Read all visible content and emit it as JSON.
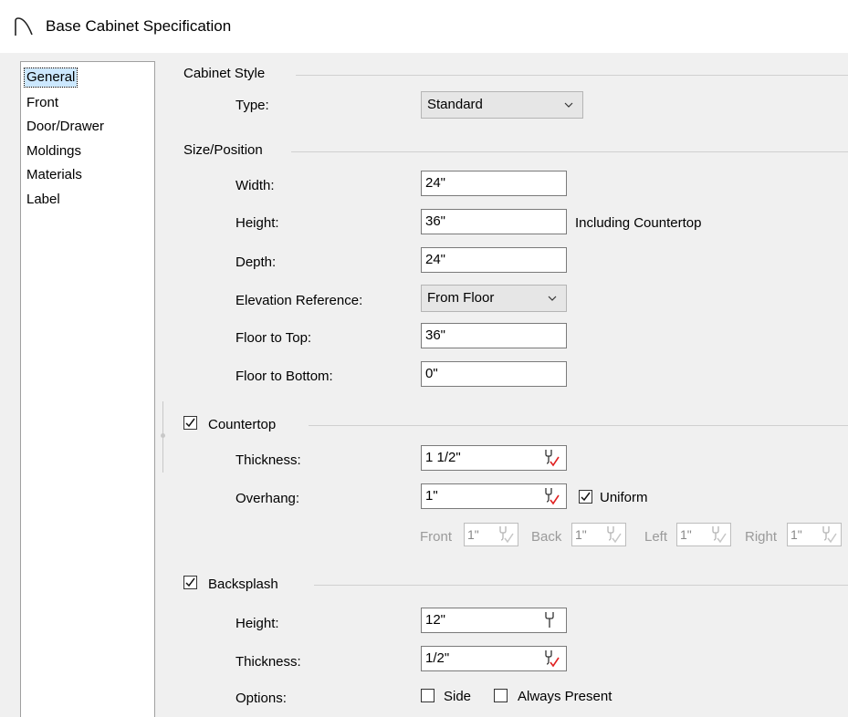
{
  "window": {
    "title": "Base Cabinet Specification"
  },
  "sidebar": {
    "items": [
      "General",
      "Front",
      "Door/Drawer",
      "Moldings",
      "Materials",
      "Label"
    ]
  },
  "cabinet_style": {
    "header": "Cabinet Style",
    "type_label": "Type:",
    "type_value": "Standard"
  },
  "size_position": {
    "header": "Size/Position",
    "width_label": "Width:",
    "width_value": "24\"",
    "height_label": "Height:",
    "height_value": "36\"",
    "height_note": "Including Countertop",
    "depth_label": "Depth:",
    "depth_value": "24\"",
    "elev_label": "Elevation Reference:",
    "elev_value": "From Floor",
    "floor_top_label": "Floor to Top:",
    "floor_top_value": "36\"",
    "floor_bottom_label": "Floor to Bottom:",
    "floor_bottom_value": "0\""
  },
  "countertop": {
    "header": "Countertop",
    "checked": true,
    "thickness_label": "Thickness:",
    "thickness_value": "1 1/2\"",
    "overhang_label": "Overhang:",
    "overhang_value": "1\"",
    "uniform_label": "Uniform",
    "uniform_checked": true,
    "front_label": "Front",
    "front_value": "1\"",
    "back_label": "Back",
    "back_value": "1\"",
    "left_label": "Left",
    "left_value": "1\"",
    "right_label": "Right",
    "right_value": "1\""
  },
  "backsplash": {
    "header": "Backsplash",
    "checked": true,
    "height_label": "Height:",
    "height_value": "12\"",
    "thickness_label": "Thickness:",
    "thickness_value": "1/2\"",
    "options_label": "Options:",
    "side_label": "Side",
    "side_checked": false,
    "always_label": "Always Present",
    "always_checked": false
  },
  "icons": {
    "title": "cabinet-arc-icon",
    "wrench": "wrench-icon",
    "wrench_check": "wrench-check-icon",
    "dropdown": "chevron-down-icon",
    "check": "checkmark-icon"
  },
  "colors": {
    "selection": "#cce8ff",
    "check_accent": "#e02020"
  }
}
